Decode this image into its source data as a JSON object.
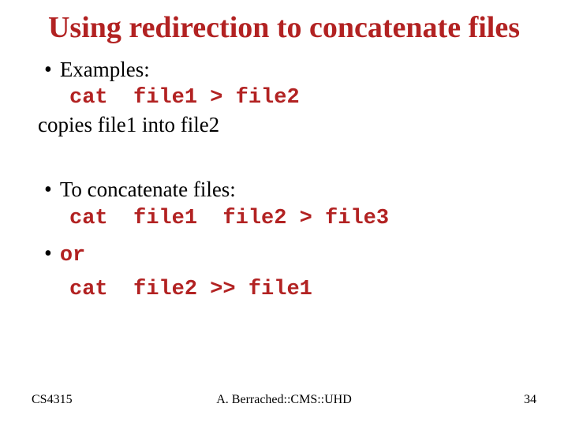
{
  "title": "Using redirection to concatenate files",
  "bullets": {
    "examples_label": "Examples:",
    "cmd1": "cat  file1 > file2",
    "copies_line": "copies file1 into file2",
    "concat_label": "To concatenate files:",
    "cmd2": "cat  file1  file2 > file3",
    "or_label": "or",
    "cmd3": "cat  file2 >> file1"
  },
  "footer": {
    "left": "CS4315",
    "center": "A. Berrached::CMS::UHD",
    "right": "34"
  }
}
